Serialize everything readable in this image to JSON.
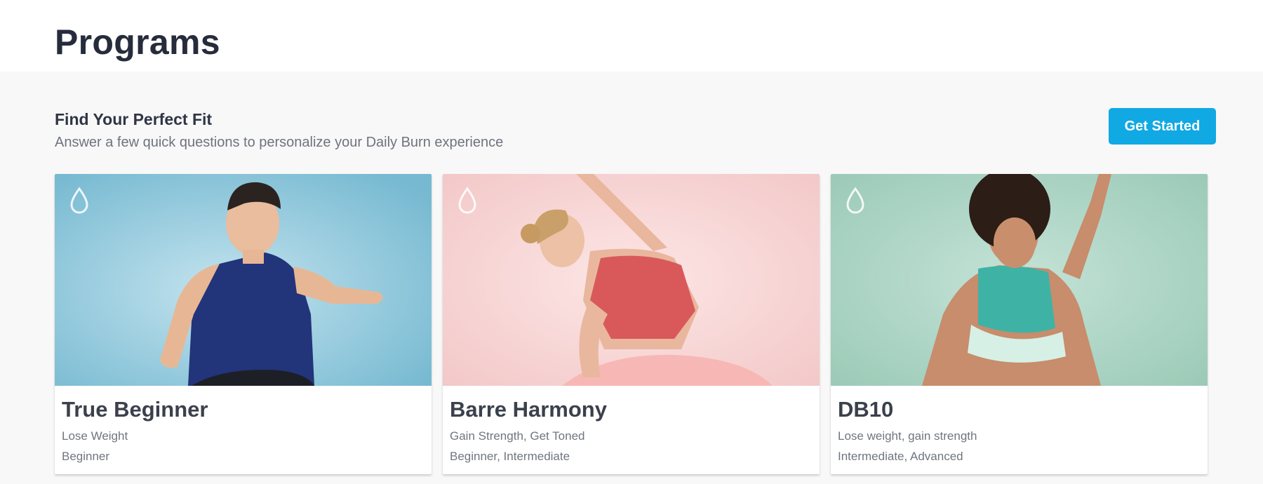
{
  "header": {
    "title": "Programs"
  },
  "finder": {
    "title": "Find Your Perfect Fit",
    "subtitle": "Answer a few quick questions to personalize your Daily Burn experience",
    "cta_label": "Get Started"
  },
  "colors": {
    "accent": "#10a9e3",
    "card1_bg": "#7dbfd6",
    "card2_bg": "#f6d0d0",
    "card3_bg": "#a7d1c0"
  },
  "programs": [
    {
      "title": "True Beginner",
      "goal": "Lose Weight",
      "level": "Beginner",
      "icon": "drop-logo-icon"
    },
    {
      "title": "Barre Harmony",
      "goal": "Gain Strength, Get Toned",
      "level": "Beginner, Intermediate",
      "icon": "drop-logo-icon"
    },
    {
      "title": "DB10",
      "goal": "Lose weight, gain strength",
      "level": "Intermediate, Advanced",
      "icon": "drop-logo-icon"
    }
  ]
}
